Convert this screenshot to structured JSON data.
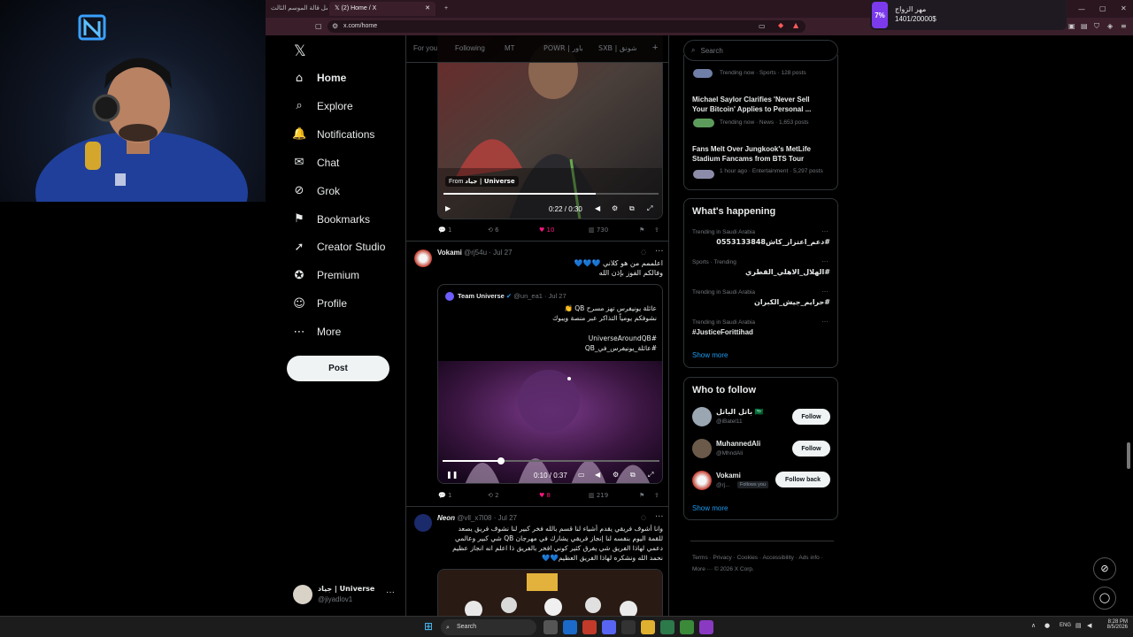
{
  "browser": {
    "tabs": [
      {
        "label": "مسلسل قالة الموسم الثالث"
      },
      {
        "label": "(2) Home / X"
      }
    ],
    "url": "x.com/home"
  },
  "notification": {
    "percent": "7%",
    "title": "مهر الزواج",
    "value": "1401/20000$"
  },
  "nav": {
    "items": [
      {
        "label": "Home",
        "icon": "home-icon"
      },
      {
        "label": "Explore",
        "icon": "search-icon"
      },
      {
        "label": "Notifications",
        "icon": "bell-icon"
      },
      {
        "label": "Chat",
        "icon": "chat-icon"
      },
      {
        "label": "Grok",
        "icon": "grok-icon"
      },
      {
        "label": "Bookmarks",
        "icon": "bookmark-icon"
      },
      {
        "label": "Creator Studio",
        "icon": "rocket-icon"
      },
      {
        "label": "Premium",
        "icon": "premium-icon"
      },
      {
        "label": "Profile",
        "icon": "person-icon"
      },
      {
        "label": "More",
        "icon": "more-icon"
      }
    ],
    "post_label": "Post",
    "account": {
      "name": "جياد | Universe",
      "handle": "@jiyadlov1"
    }
  },
  "timeline": {
    "tabs": [
      "For you",
      "Following",
      "MT",
      "POWR | باور",
      "SXB | شونق"
    ],
    "post1": {
      "from_label": "From",
      "from_account": "جياد | Universe",
      "time": "0:22 / 0:30",
      "replies": "1",
      "reposts": "6",
      "likes": "10",
      "views": "730"
    },
    "post2": {
      "name": "Vokami",
      "handle": "@rj54u",
      "date": "Jul 27",
      "text_line1": "اعلممم من هو كلاني 💙💙💙",
      "text_line2": "وفالكم الفوز بإذن الله",
      "quote": {
        "name": "Team Universe",
        "handle": "@un_ea1",
        "date": "Jul 27",
        "line1": "عائلة يونيفرس تهز مسرح QB 👏",
        "line2": "نشوفكم يومياً التذاكر عبر منصة ويبوك",
        "line3": "#UniverseAroundQB",
        "line4": "#عائلة_يونيفرس_في_QB"
      },
      "time": "0:10 / 0:37",
      "progress": 0.27,
      "replies": "1",
      "reposts": "2",
      "likes": "8",
      "views": "219"
    },
    "post3": {
      "name": "Neon",
      "handle": "@vll_x7l08",
      "date": "Jul 27",
      "line1": "وانا أشوف فريقي يقدم أشياء لنا قسم بالله فخر كبير لنا نشوف فريق يصعد",
      "line2": "للقمة اليوم بنفسه لنا إنجاز فريقي يشارك في مهرجان QB شي كبير وعالمي",
      "line3": "دعمي لهاذا الفريق شي يفرق كثير كوني افخر بالفريق ذا اعلم انه انجاز عظيم",
      "line4": "نحمد الله ونشكره لهاذا الفريق العظيم💙💙"
    }
  },
  "right": {
    "search_placeholder": "Search",
    "news": [
      {
        "meta": "Trending now · Sports · 128 posts"
      },
      {
        "title": "Michael Saylor Clarifies 'Never Sell Your Bitcoin' Applies to Personal ...",
        "meta": "Trending now · News · 1,653 posts"
      },
      {
        "title": "Fans Melt Over Jungkook's MetLife Stadium Fancams from BTS Tour",
        "meta": "1 hour ago · Entertainment · 5,297 posts"
      }
    ],
    "happening": {
      "title": "What's happening",
      "trends": [
        {
          "context": "Trending in Saudi Arabia",
          "name": "#دعم_اعتزاز_كاش0553133848"
        },
        {
          "context": "Sports · Trending",
          "name": "#الهلال_الاهلي_القطري"
        },
        {
          "context": "Trending in Saudi Arabia",
          "name": "#حرايم_جيش_الكبران"
        },
        {
          "context": "Trending in Saudi Arabia",
          "name": "#JusticeForittihad"
        }
      ],
      "show_more": "Show more"
    },
    "who_to_follow": {
      "title": "Who to follow",
      "users": [
        {
          "name": "باتل الباتل 🇸🇦",
          "handle": "@iBatel11",
          "button": "Follow"
        },
        {
          "name": "MuhannedAli",
          "handle": "@MhndAli",
          "button": "Follow"
        },
        {
          "name": "Vokami",
          "handle": "@rj...",
          "badge": "Follows you",
          "button": "Follow back"
        }
      ],
      "show_more": "Show more"
    },
    "footer": {
      "links": [
        "Terms",
        "Privacy",
        "Cookies",
        "Accessibility",
        "Ads info",
        "More ···",
        "© 2026 X Corp."
      ]
    }
  },
  "taskbar": {
    "search": "Search",
    "lang": "ENG",
    "time": "8:28 PM",
    "date": "8/5/2026"
  },
  "colors": {
    "accent": "#1d9bf0",
    "like": "#f91880",
    "background": "#000000",
    "border": "#2f3336"
  }
}
